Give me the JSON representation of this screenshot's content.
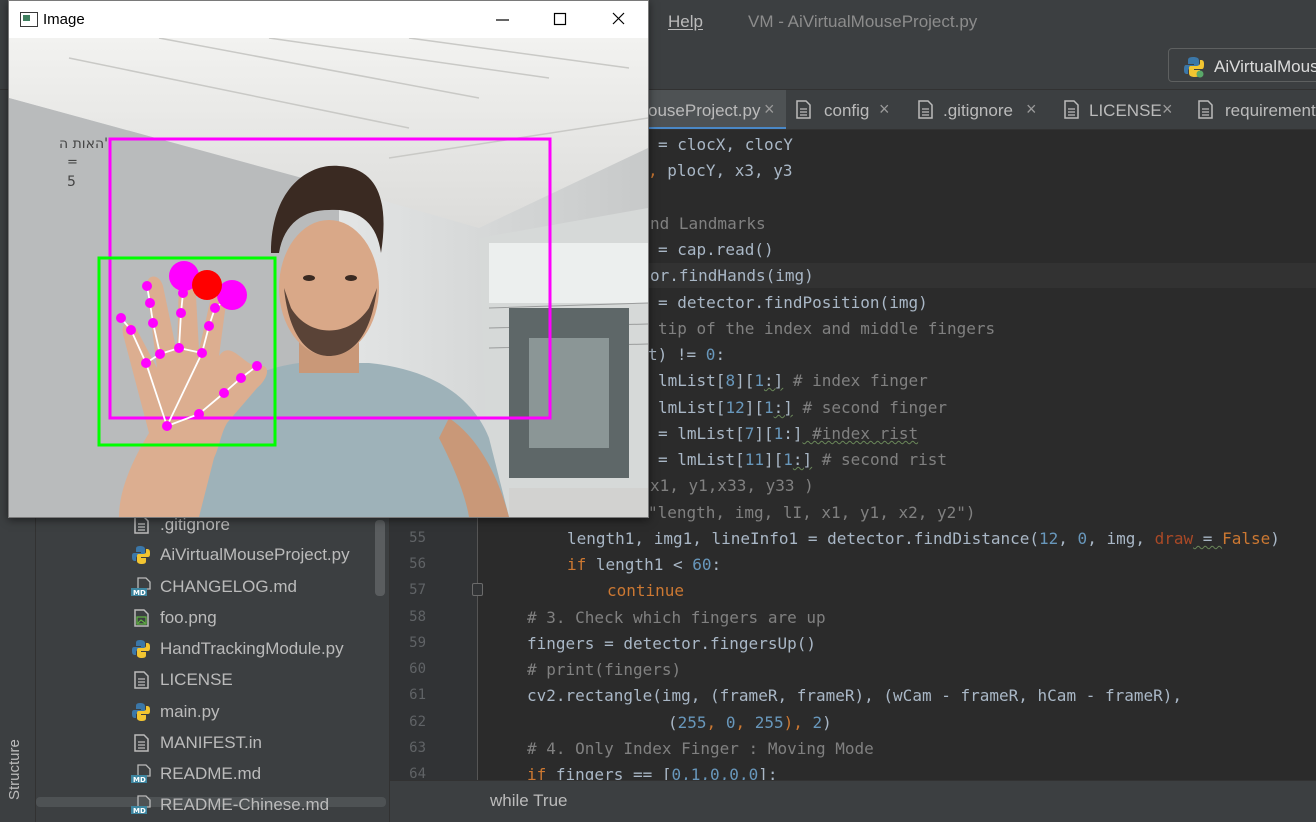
{
  "ide": {
    "menu": {
      "help": "Help",
      "title": "VM - AiVirtualMouseProject.py"
    },
    "run_config": {
      "label": "AiVirtualMouse"
    },
    "tabs": [
      {
        "label": "ouseProject.py"
      },
      {
        "label": "config"
      },
      {
        "label": ".gitignore"
      },
      {
        "label": "LICENSE"
      },
      {
        "label": "requirement"
      }
    ],
    "tool_window": {
      "structure": "Structure"
    },
    "project_tree": [
      {
        "label": ".gitignore",
        "icon": "file-icon"
      },
      {
        "label": "AiVirtualMouseProject.py",
        "icon": "python-file-icon"
      },
      {
        "label": "CHANGELOG.md",
        "icon": "markdown-icon"
      },
      {
        "label": "foo.png",
        "icon": "image-file-icon"
      },
      {
        "label": "HandTrackingModule.py",
        "icon": "python-file-icon"
      },
      {
        "label": "LICENSE",
        "icon": "file-icon"
      },
      {
        "label": "main.py",
        "icon": "python-file-icon"
      },
      {
        "label": "MANIFEST.in",
        "icon": "file-icon"
      },
      {
        "label": "README.md",
        "icon": "markdown-icon"
      },
      {
        "label": "README-Chinese.md",
        "icon": "markdown-icon"
      }
    ],
    "line_numbers": [
      "55",
      "56",
      "57",
      "58",
      "59",
      "60",
      "61",
      "62",
      "63",
      "64"
    ],
    "code_fragments": {
      "l40": "= clocX, clocY",
      "l41a": ",",
      "l41b": "plocY, x3, y3",
      "l43": "nd Landmarks",
      "l44": "= cap.read()",
      "l45": "or.findHands(img)",
      "l46": "= detector.findPosition(img)",
      "l47": "tip of the index and middle fingers",
      "l48a": "t) != ",
      "l48n": "0",
      "l48b": ":",
      "l49a": "lmList[",
      "l49n1": "8",
      "l49b": "][",
      "l49n2": "1",
      "l49c": ":]",
      "l49d": " # index finger",
      "l50a": "lmList[",
      "l50n1": "12",
      "l50b": "][",
      "l50n2": "1",
      "l50c": ":]",
      "l50d": " # second finger",
      "l51a": "= lmList[",
      "l51n1": "7",
      "l51b": "][",
      "l51n2": "1",
      "l51c": ":]",
      "l51d": " #index rist",
      "l52a": "= lmList[",
      "l52n1": "11",
      "l52b": "][",
      "l52n2": "1",
      "l52c": ":]",
      "l52d": " # second rist",
      "l53": "x1, y1,x33, y33 )",
      "l54": "\"length, img, lI, x1, y1, x2, y2\")",
      "l55a": "length1, img1, lineInfo1 = detector.findDistance(",
      "l55n1": "12",
      "l55b": ", ",
      "l55n2": "0",
      "l55c": ", img, ",
      "l55p": "draw",
      "l55d": " = ",
      "l55k": "False",
      "l55e": ")",
      "l56k": "if",
      "l56a": " length1 < ",
      "l56n": "60",
      "l56b": ":",
      "l57k": "continue",
      "l58": "# 3. Check which fingers are up",
      "l59": "fingers = detector.fingersUp()",
      "l60": "# print(fingers)",
      "l61a": "cv2.rectangle(img, (frameR, frameR), (wCam - frameR, hCam - frameR),",
      "l62o": "(",
      "l62n1": "255",
      "l62c1": ", ",
      "l62n2": "0",
      "l62c2": ", ",
      "l62n3": "255",
      "l62c3": "), ",
      "l62n4": "2",
      "l62e": ")",
      "l63": "# 4. Only Index Finger : Moving Mode",
      "l64k": "if",
      "l64a": " fingers == [",
      "l64n": "0,1,0,0,0",
      "l64b": "]:"
    },
    "breadcrumb": "while True"
  },
  "image_window": {
    "title": "Image",
    "whiteboard_text": [
      "האות ה'",
      "=",
      "5"
    ],
    "colors": {
      "frame_rect": "#ff00ff",
      "hand_bbox": "#00ff00",
      "landmark": "#ff00ff",
      "fingertip_click": "#ff0000",
      "skeleton": "#ffffff"
    }
  }
}
